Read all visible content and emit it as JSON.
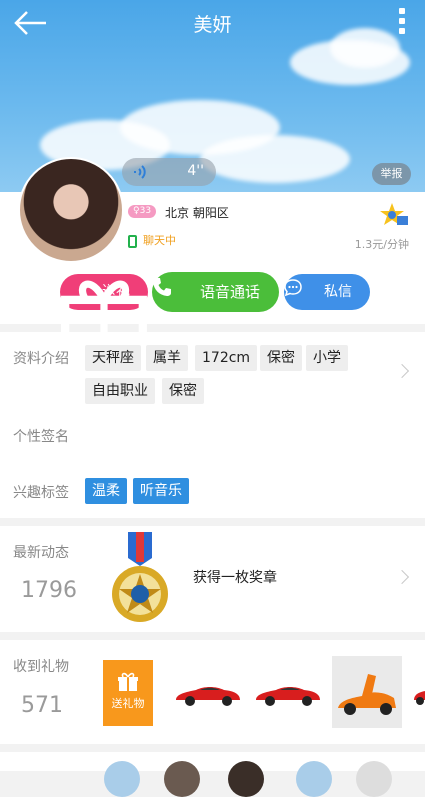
{
  "header": {
    "title": "美妍",
    "back_icon": "back-arrow-icon",
    "menu_icon": "more-vertical-icon"
  },
  "voice": {
    "duration": "4''"
  },
  "report_label": "举报",
  "profile": {
    "age_badge": "33",
    "location": "北京 朝阳区",
    "status": "聊天中",
    "price": "1.3元/分钟",
    "status_color": "#f0a020"
  },
  "actions": {
    "gift_label": "送礼",
    "call_label": "语音通话",
    "message_label": "私信",
    "colors": {
      "gift": "#f03e78",
      "call": "#4bbe3a",
      "message": "#3f90e8"
    }
  },
  "intro": {
    "label": "资料介绍",
    "tags": [
      "天秤座",
      "属羊",
      "172cm",
      "保密",
      "小学",
      "自由职业",
      "保密"
    ]
  },
  "signature": {
    "label": "个性签名"
  },
  "interests": {
    "label": "兴趣标签",
    "tags": [
      "温柔",
      "听音乐"
    ]
  },
  "moments": {
    "label": "最新动态",
    "count": "1796",
    "text": "获得一枚奖章"
  },
  "gifts": {
    "label": "收到礼物",
    "count": "571",
    "send_label": "送礼物"
  }
}
